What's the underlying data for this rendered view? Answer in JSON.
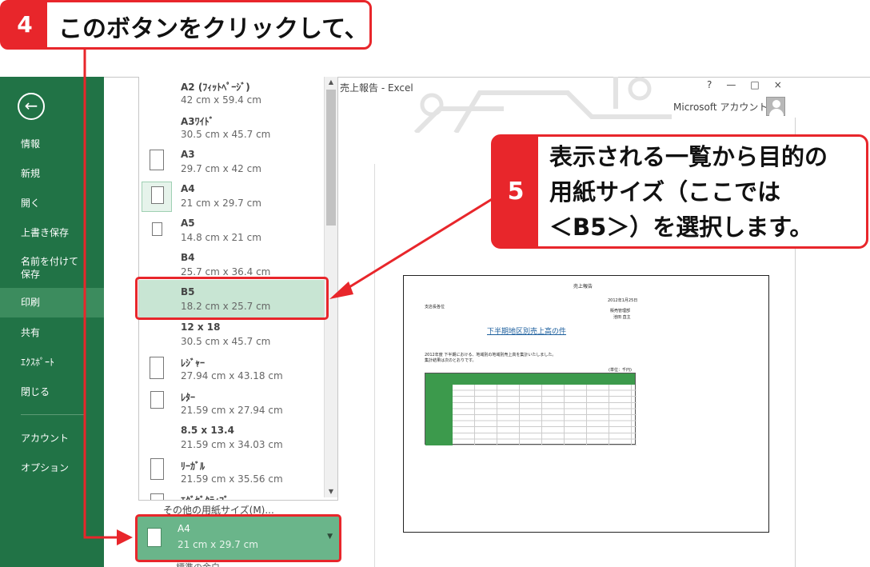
{
  "callout_step4": {
    "number": "4",
    "text": "このボタンをクリックして、"
  },
  "callout_step5": {
    "number": "5",
    "lines": [
      "表示される一覧から目的の",
      "用紙サイズ（ここでは",
      "＜B5＞）を選択します。"
    ]
  },
  "window": {
    "title": "売上報告 - Excel",
    "controls": [
      "?",
      "—",
      "□",
      "×"
    ],
    "account_label": "Microsoft アカウント ▾"
  },
  "sidebar": {
    "back_icon": "back-arrow-icon",
    "items": [
      {
        "label": "情報"
      },
      {
        "label": "新規"
      },
      {
        "label": "開く"
      },
      {
        "label": "上書き保存"
      },
      {
        "label": "名前を付けて",
        "label2": "保存"
      },
      {
        "label": "印刷",
        "active": true
      },
      {
        "label": "共有"
      },
      {
        "label": "ｴｸｽﾎﾟｰﾄ"
      },
      {
        "label": "閉じる"
      },
      {
        "label": "アカウント"
      },
      {
        "label": "オプション"
      }
    ],
    "colors": {
      "background": "#217346",
      "active": "#3c8c5e"
    }
  },
  "paper_sizes": [
    {
      "name": "A2 (ﾌｨｯﾄﾍﾟｰｼﾞ)",
      "dims": "42 cm x 59.4 cm"
    },
    {
      "name": "A3ﾜｲﾄﾞ",
      "dims": "30.5 cm x 45.7 cm"
    },
    {
      "name": "A3",
      "dims": "29.7 cm x 42 cm"
    },
    {
      "name": "A4",
      "dims": "21 cm x 29.7 cm",
      "current": true
    },
    {
      "name": "A5",
      "dims": "14.8 cm x 21 cm"
    },
    {
      "name": "B4",
      "dims": "25.7 cm x 36.4 cm"
    },
    {
      "name": "B5",
      "dims": "18.2 cm x 25.7 cm",
      "selected": true
    },
    {
      "name": "12 x 18",
      "dims": "30.5 cm x 45.7 cm"
    },
    {
      "name": "ﾚｼﾞｬｰ",
      "dims": "27.94 cm x 43.18 cm"
    },
    {
      "name": "ﾚﾀｰ",
      "dims": "21.59 cm x 27.94 cm"
    },
    {
      "name": "8.5 x 13.4",
      "dims": "21.59 cm x 34.03 cm"
    },
    {
      "name": "ﾘｰｶﾞﾙ",
      "dims": "21.59 cm x 35.56 cm"
    },
    {
      "name": "ｴｸﾞｾﾞｸﾃｨﾌﾞ",
      "dims": ""
    }
  ],
  "more_sizes_label": "その他の用紙サイズ(M)...",
  "current_size": {
    "name": "A4",
    "dims": "21 cm x 29.7 cm"
  },
  "below_label": "標準の余白",
  "preview": {
    "title": "売上報告",
    "date": "2012年1月25日",
    "to": "支店長各位",
    "dept": "販売管理部",
    "name": "池田 直主",
    "heading": "下半期地区別売上高の件",
    "body1": "2012年度 下半期における、地域別の地域別売上高を集計いたしました。",
    "body2": "集計結果は次のとおりです。",
    "unit": "(単位：千円)"
  }
}
